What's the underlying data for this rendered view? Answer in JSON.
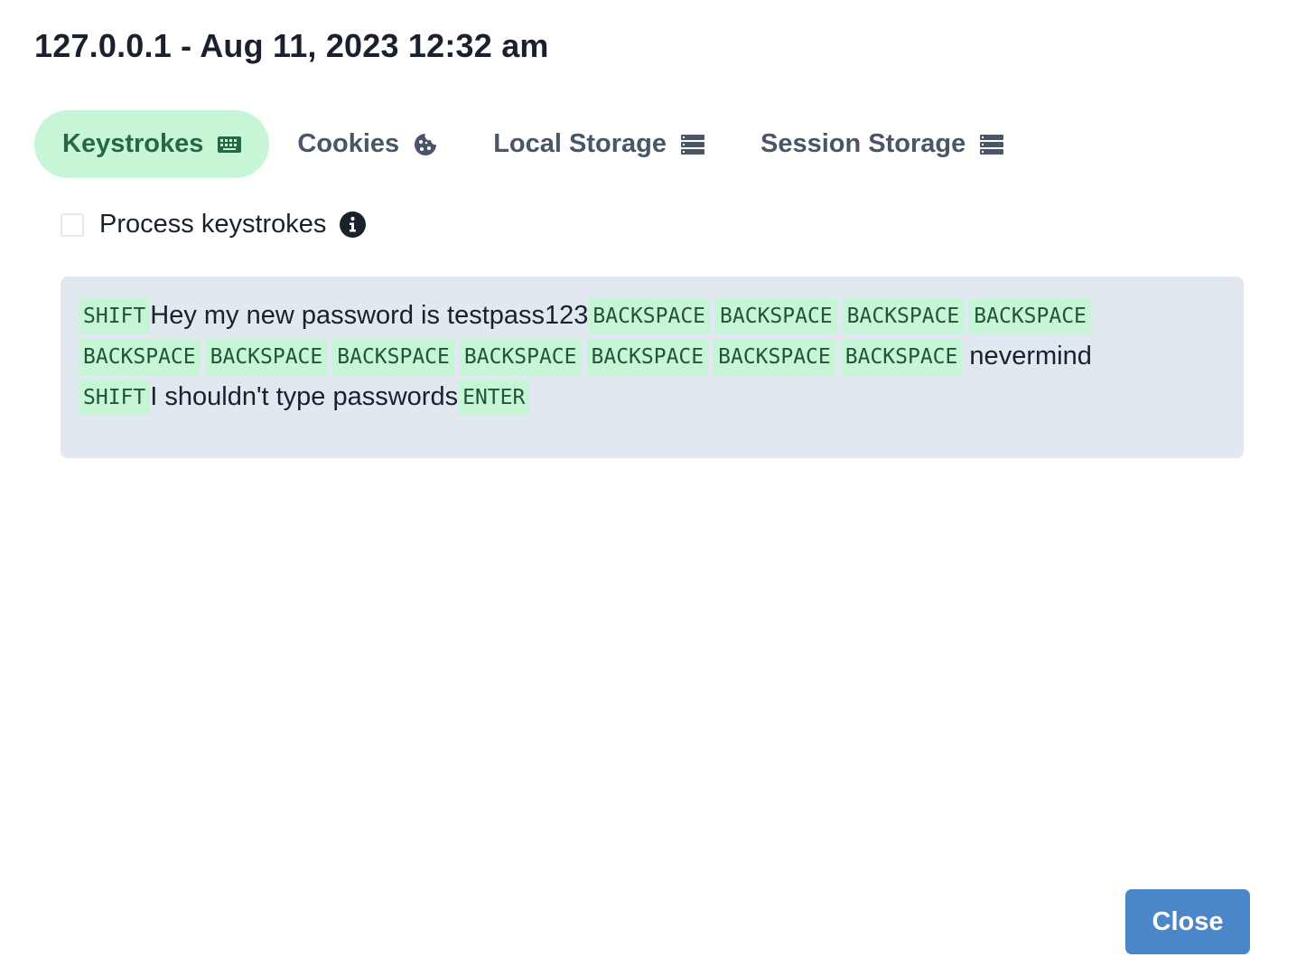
{
  "header": {
    "title": "127.0.0.1 - Aug 11, 2023 12:32 am"
  },
  "tabs": [
    {
      "label": "Keystrokes",
      "icon": "keyboard-icon",
      "active": true
    },
    {
      "label": "Cookies",
      "icon": "cookie-icon",
      "active": false
    },
    {
      "label": "Local Storage",
      "icon": "database-icon",
      "active": false
    },
    {
      "label": "Session Storage",
      "icon": "database-icon",
      "active": false
    }
  ],
  "process_keystrokes": {
    "label": "Process keystrokes",
    "checked": false,
    "info_icon": "info-icon"
  },
  "keystrokes": {
    "lines": [
      [
        {
          "type": "key",
          "text": "SHIFT"
        },
        {
          "type": "text",
          "text": "Hey my new password is testpass123"
        },
        {
          "type": "key",
          "text": "BACKSPACE"
        },
        {
          "type": "key",
          "text": "BACKSPACE"
        },
        {
          "type": "key",
          "text": "BACKSPACE"
        },
        {
          "type": "key",
          "text": "BACKSPACE"
        }
      ],
      [
        {
          "type": "key",
          "text": "BACKSPACE"
        },
        {
          "type": "key",
          "text": "BACKSPACE"
        },
        {
          "type": "key",
          "text": "BACKSPACE"
        },
        {
          "type": "key",
          "text": "BACKSPACE"
        },
        {
          "type": "key",
          "text": "BACKSPACE"
        },
        {
          "type": "key",
          "text": "BACKSPACE"
        },
        {
          "type": "key",
          "text": "BACKSPACE"
        },
        {
          "type": "text",
          "text": " nevermind"
        }
      ],
      [
        {
          "type": "key",
          "text": "SHIFT"
        },
        {
          "type": "text",
          "text": "I shouldn't type passwords"
        },
        {
          "type": "key",
          "text": "ENTER"
        }
      ]
    ]
  },
  "footer": {
    "close_label": "Close"
  },
  "colors": {
    "tab_active_bg": "#c6f6d5",
    "tab_active_text": "#276749",
    "key_bg": "#c6f6d5",
    "panel_bg": "#e2e8f0",
    "close_bg": "#4a86c8"
  }
}
